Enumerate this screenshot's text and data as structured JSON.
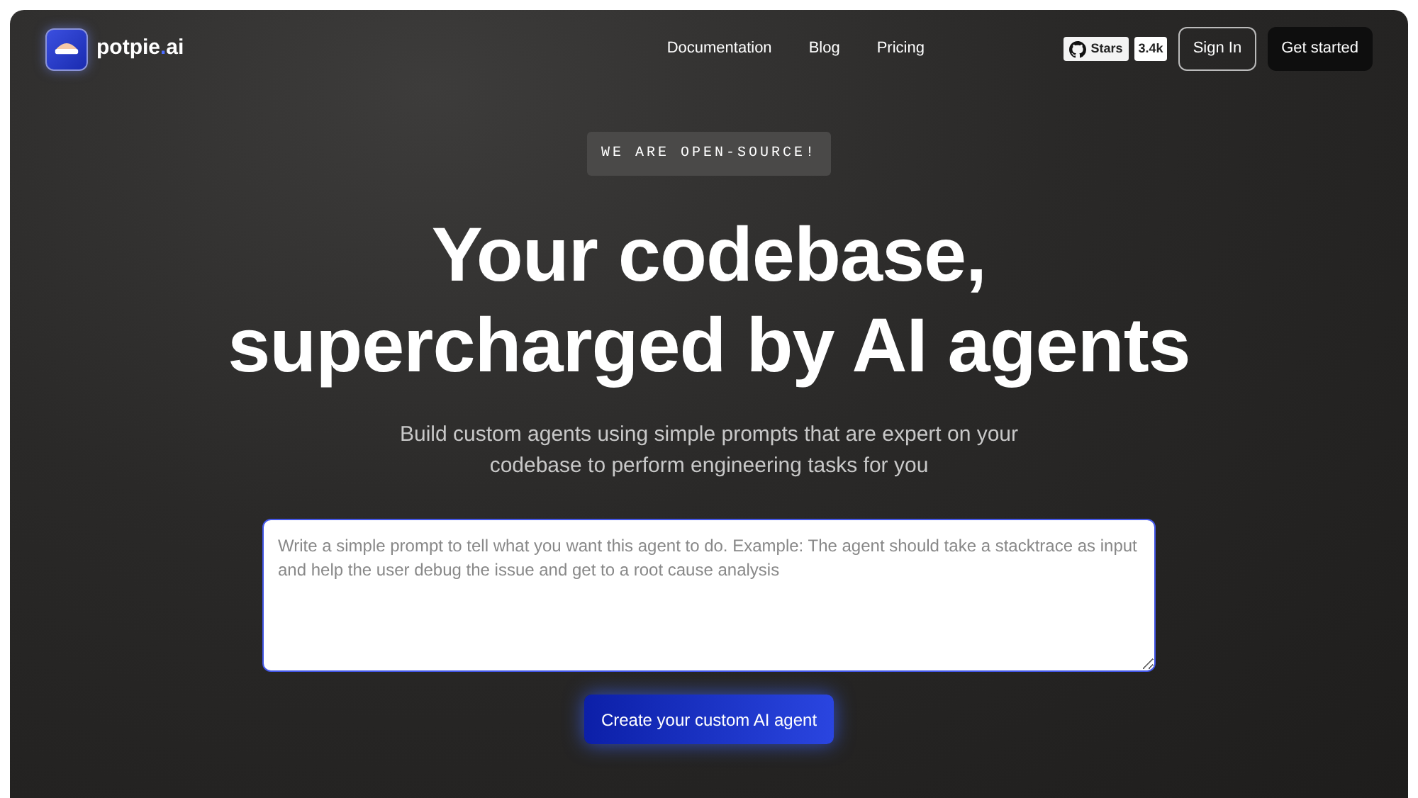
{
  "brand": {
    "name": "potpie",
    "dot": ".",
    "suffix": "ai"
  },
  "nav": [
    "Documentation",
    "Blog",
    "Pricing"
  ],
  "github": {
    "label": "Stars",
    "count": "3.4k"
  },
  "actions": {
    "sign_in": "Sign In",
    "get_started": "Get started"
  },
  "badge": "WE ARE OPEN-SOURCE!",
  "headline": [
    "Your codebase,",
    "supercharged by AI agents"
  ],
  "subtitle": "Build custom agents using simple prompts that are expert on your codebase to perform engineering tasks for you",
  "prompt": {
    "placeholder": "Write a simple prompt to tell what you want this agent to do. Example: The agent should take a stacktrace as input and help the user debug the issue and get to a root cause analysis"
  },
  "cta": "Create your custom AI agent"
}
